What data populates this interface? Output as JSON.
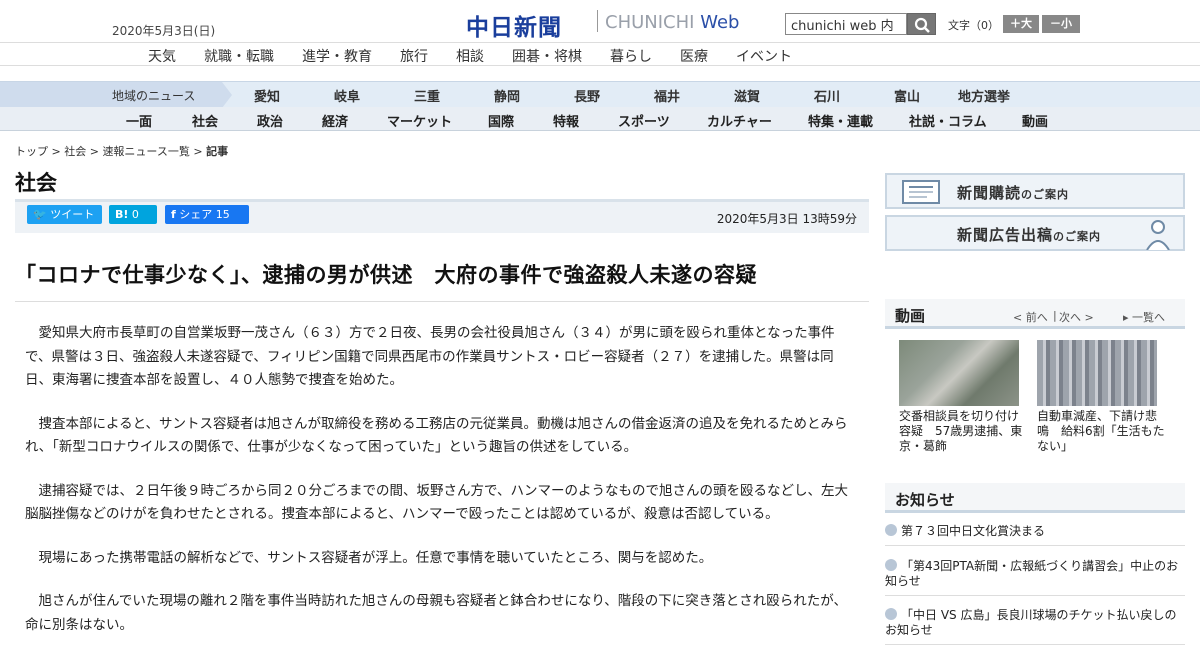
{
  "header": {
    "date": "2020年5月3日(日)",
    "logo_jp": "中日新聞",
    "logo_en": "CHUNICHI",
    "logo_web": "Web",
    "search_value": "chunichi web 内",
    "fontsize_label": "文字（0）",
    "font_larger": "＋大",
    "font_smaller": "－小"
  },
  "categories": [
    "天気",
    "就職・転職",
    "進学・教育",
    "旅行",
    "相談",
    "囲碁・将棋",
    "暮らし",
    "医療",
    "イベント"
  ],
  "region_nav": {
    "title": "地域のニュース",
    "items": [
      "愛知",
      "岐阜",
      "三重",
      "静岡",
      "長野",
      "福井",
      "滋賀",
      "石川",
      "富山",
      "地方選挙"
    ]
  },
  "main_nav": [
    "一面",
    "社会",
    "政治",
    "経済",
    "マーケット",
    "国際",
    "特報",
    "スポーツ",
    "カルチャー",
    "特集・連載",
    "社説・コラム",
    "動画"
  ],
  "breadcrumb": {
    "top": "トップ",
    "social": "社会",
    "flash": "速報ニュース一覧",
    "current": "記事",
    "sep": ">"
  },
  "section_title": "社会",
  "share": {
    "tweet": "ツイート",
    "hatena_count": "0",
    "fb_label": "シェア",
    "fb_count": "15"
  },
  "pubdate": "2020年5月3日 13時59分",
  "headline": "「コロナで仕事少なく」、逮捕の男が供述　大府の事件で強盗殺人未遂の容疑",
  "body": [
    "愛知県大府市長草町の自営業坂野一茂さん（６３）方で２日夜、長男の会社役員旭さん（３４）が男に頭を殴られ重体となった事件で、県警は３日、強盗殺人未遂容疑で、フィリピン国籍で同県西尾市の作業員サントス・ロビー容疑者（２７）を逮捕した。県警は同日、東海署に捜査本部を設置し、４０人態勢で捜査を始めた。",
    "捜査本部によると、サントス容疑者は旭さんが取締役を務める工務店の元従業員。動機は旭さんの借金返済の追及を免れるためとみられ、「新型コロナウイルスの関係で、仕事が少なくなって困っていた」という趣旨の供述をしている。",
    "逮捕容疑では、２日午後９時ごろから同２０分ごろまでの間、坂野さん方で、ハンマーのようなもので旭さんの頭を殴るなどし、左大脳脳挫傷などのけがを負わせたとされる。捜査本部によると、ハンマーで殴ったことは認めているが、殺意は否認している。",
    "現場にあった携帯電話の解析などで、サントス容疑者が浮上。任意で事情を聴いていたところ、関与を認めた。",
    "旭さんが住んでいた現場の離れ２階を事件当時訪れた旭さんの母親も容疑者と鉢合わせになり、階段の下に突き落とされ殴られたが、命に別条はない。"
  ],
  "sidebar": {
    "banner1": {
      "main": "新聞購読",
      "sub": "のご案内"
    },
    "banner2": {
      "main": "新聞広告出稿",
      "sub": "のご案内"
    },
    "video": {
      "title": "動画",
      "prev": "< 前へ",
      "next": "次へ >",
      "sep": "|",
      "list": "一覧へ",
      "items": [
        {
          "caption": "交番相談員を切り付け容疑　57歳男逮捕、東京・葛飾"
        },
        {
          "caption": "自動車減産、下請け悲鳴　給料6割「生活もたない」"
        }
      ]
    },
    "notices": {
      "title": "お知らせ",
      "items": [
        "第７３回中日文化賞決まる",
        "「第43回PTA新聞・広報紙づくり講習会」中止のお知らせ",
        "「中日 VS 広島」長良川球場のチケット払い戻しのお知らせ"
      ]
    }
  },
  "colors": {
    "brand": "#1a3e9c",
    "twitter": "#1da1f2",
    "hatena": "#00a4de",
    "facebook": "#1877f2"
  }
}
